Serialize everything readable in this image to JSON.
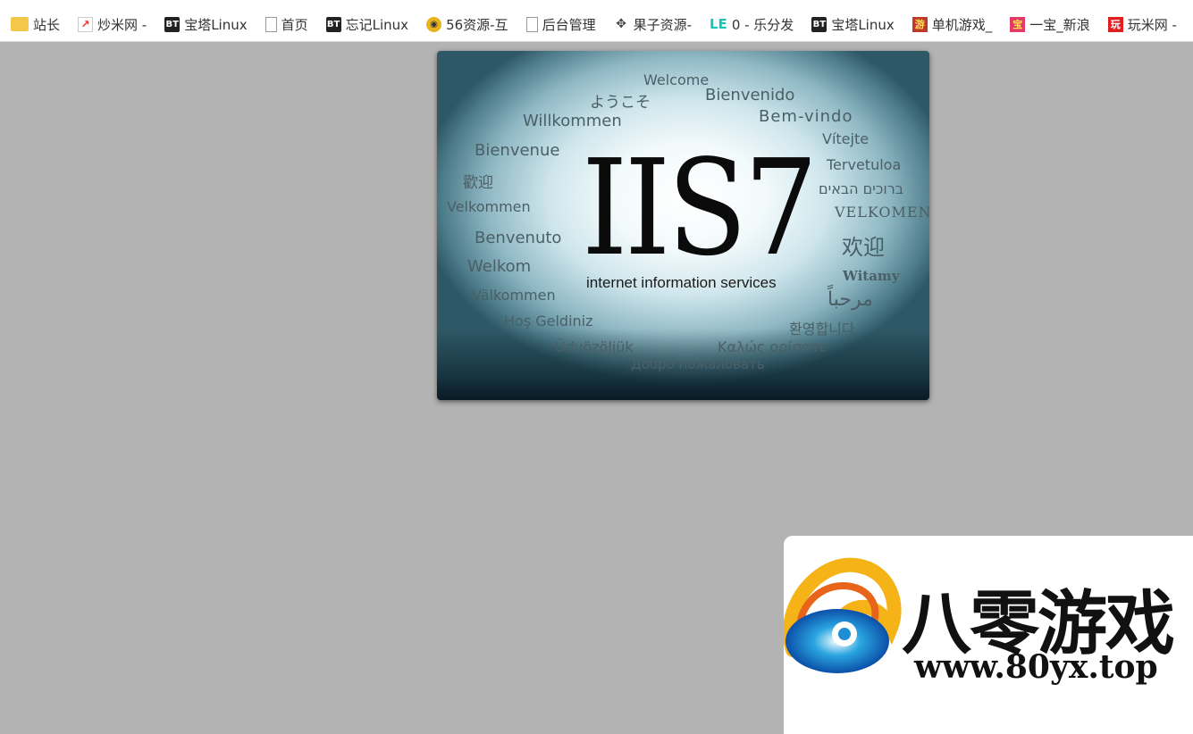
{
  "bookmarks": [
    {
      "label": "站长",
      "icon": "folder-icon"
    },
    {
      "label": "炒米网 -",
      "icon": "chart-icon"
    },
    {
      "label": "宝塔Linux",
      "icon": "bt-icon"
    },
    {
      "label": "首页",
      "icon": "page-icon"
    },
    {
      "label": "忘记Linux",
      "icon": "bt-icon"
    },
    {
      "label": "56资源-互",
      "icon": "owl-icon"
    },
    {
      "label": "后台管理",
      "icon": "page-icon"
    },
    {
      "label": "果子资源-",
      "icon": "dots-icon"
    },
    {
      "label": "0 - 乐分发",
      "icon": "le-icon"
    },
    {
      "label": "宝塔Linux",
      "icon": "bt-icon"
    },
    {
      "label": "单机游戏_",
      "icon": "game-icon"
    },
    {
      "label": "一宝_新浪",
      "icon": "game2-icon"
    },
    {
      "label": "玩米网 -",
      "icon": "wan-icon"
    }
  ],
  "icon_text": {
    "bt": "BT",
    "le": "LE",
    "game": "游",
    "game2": "宝",
    "wan": "玩",
    "chart": "↗",
    "owl": "◉",
    "dots": "✥"
  },
  "iis": {
    "logo": "IIS7",
    "tagline": "internet information services",
    "welcome_words": {
      "w1": "Welcome",
      "w2": "ようこそ",
      "w3": "Bienvenido",
      "w4": "Willkommen",
      "w5": "Bem-vindo",
      "w6": "Bienvenue",
      "w7": "Vítejte",
      "w8": "歡迎",
      "w9": "Tervetuloa",
      "w10": "ברוכים הבאים",
      "w11": "Velkommen",
      "w12": "VELKOMEN",
      "w13": "Benvenuto",
      "w14": "欢迎",
      "w15": "Welkom",
      "w16": "Witamy",
      "w17": "Välkommen",
      "w18": "مرحباً",
      "w19": "Hoş Geldiniz",
      "w20": "환영합니다",
      "w21": "Üdvözöljük",
      "w22": "Καλώς ορίσατε",
      "w23": "Добро пожаловать"
    }
  },
  "watermark": {
    "name": "八零游戏",
    "url": "www.80yx.top"
  }
}
